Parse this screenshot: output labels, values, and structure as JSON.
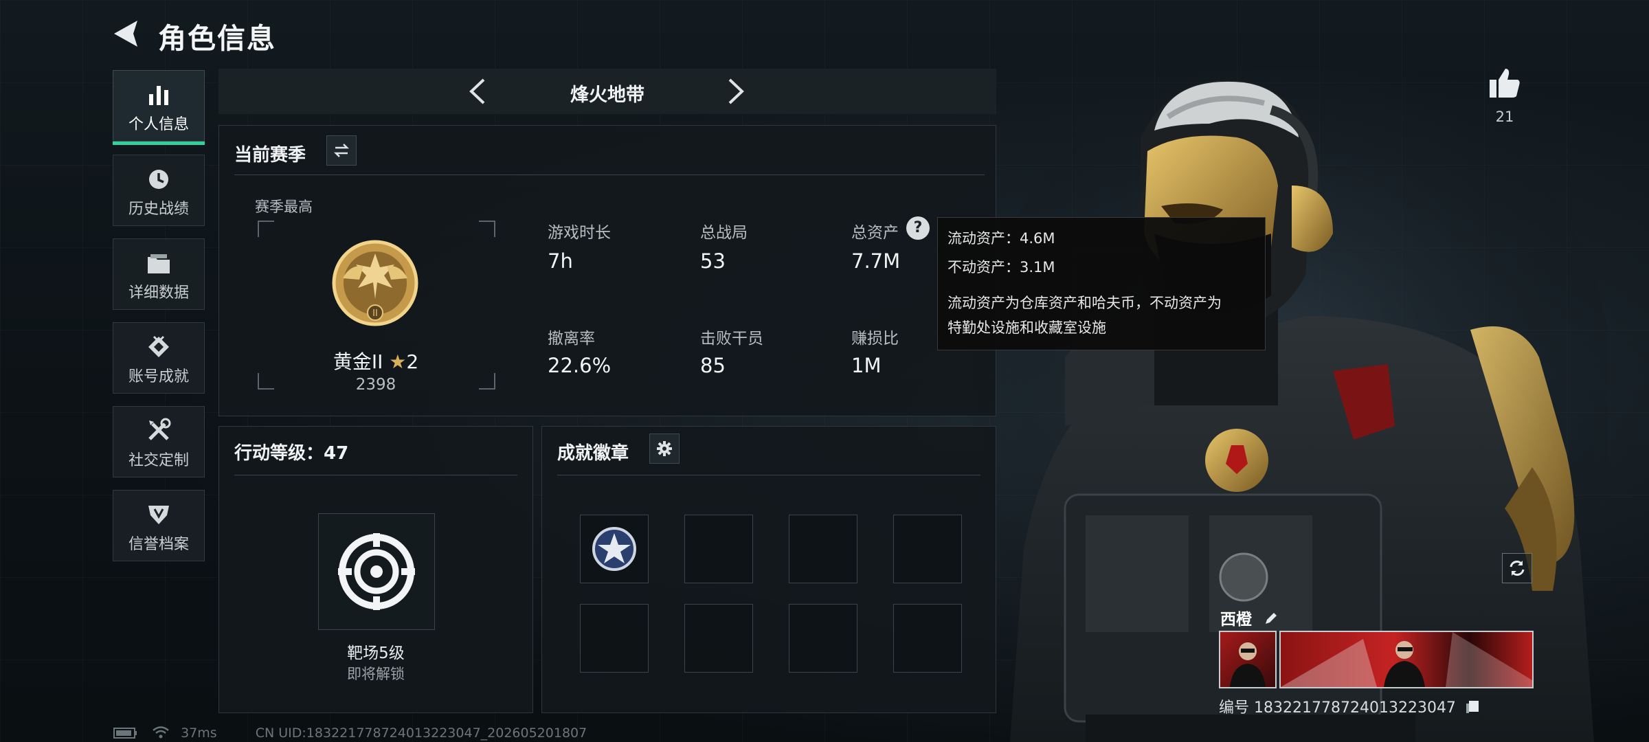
{
  "header": {
    "title": "角色信息"
  },
  "sidebar": {
    "items": [
      {
        "label": "个人信息",
        "icon": "bar-chart-icon",
        "active": true
      },
      {
        "label": "历史战绩",
        "icon": "clock-icon",
        "active": false
      },
      {
        "label": "详细数据",
        "icon": "folder-icon",
        "active": false
      },
      {
        "label": "账号成就",
        "icon": "achievement-icon",
        "active": false
      },
      {
        "label": "社交定制",
        "icon": "tools-icon",
        "active": false
      },
      {
        "label": "信誉档案",
        "icon": "shield-icon",
        "active": false
      }
    ]
  },
  "mode": {
    "title": "烽火地带"
  },
  "season": {
    "title": "当前赛季",
    "peak_label": "赛季最高",
    "rank_name": "黄金II",
    "rank_stars": "2",
    "rank_score": "2398",
    "stats": [
      {
        "label": "游戏时长",
        "value": "7h"
      },
      {
        "label": "总战局",
        "value": "53"
      },
      {
        "label": "总资产",
        "value": "7.7M"
      },
      {
        "label": "撤离率",
        "value": "22.6%"
      },
      {
        "label": "击败干员",
        "value": "85"
      },
      {
        "label": "赚损比",
        "value": "1M"
      }
    ]
  },
  "tooltip": {
    "line1": "流动资产：4.6M",
    "line2": "不动资产：3.1M",
    "line3": "流动资产为仓库资产和哈夫币，不动资产为",
    "line4": "特勤处设施和收藏室设施"
  },
  "action_level": {
    "title": "行动等级：47",
    "reward_name": "靶场5级",
    "reward_status": "即将解锁"
  },
  "achievements": {
    "title": "成就徽章"
  },
  "player": {
    "likes": "21",
    "name": "西橙",
    "id_text": "编号 183221778724013223047"
  },
  "status": {
    "ping": "37ms",
    "uid": "CN UID:183221778724013223047_202605201807"
  },
  "colors": {
    "accent": "#32d398",
    "gold": "#d7b25a"
  }
}
